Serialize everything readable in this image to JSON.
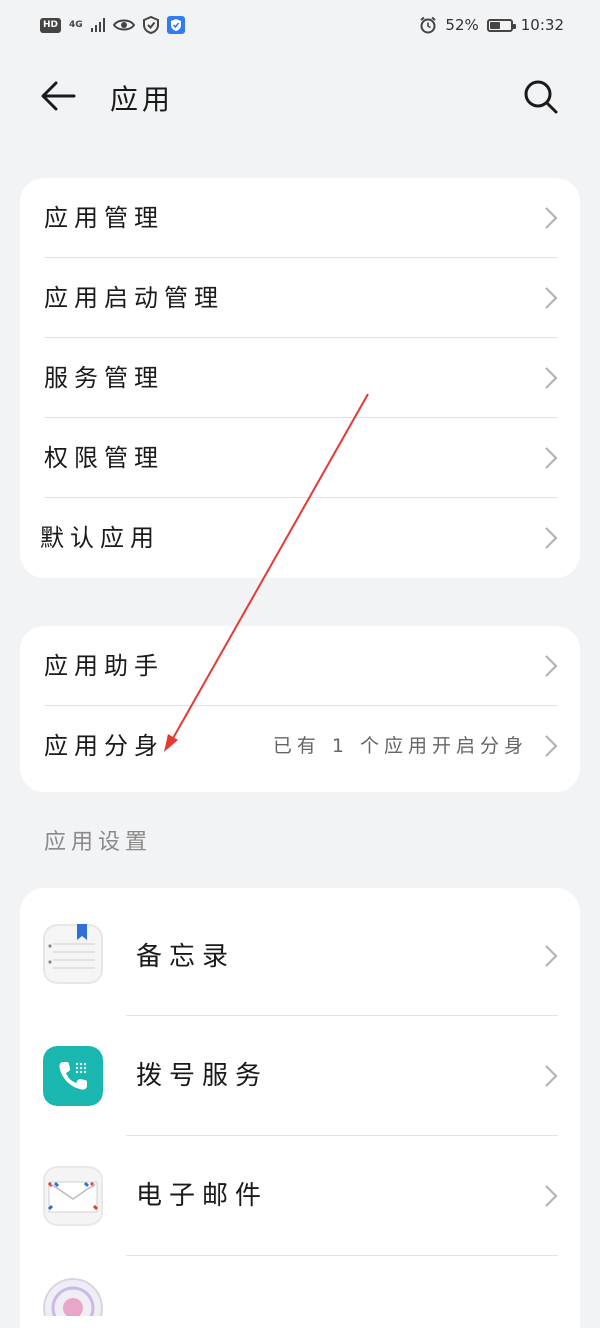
{
  "status_bar": {
    "left_badges": {
      "hd": "HD",
      "network": "4G"
    },
    "battery_percent_text": "52%",
    "battery_level": 0.52,
    "time": "10:32",
    "icons": [
      "hd-icon",
      "signal-icon",
      "eye-icon",
      "shield-check-icon",
      "vpn-shield-icon",
      "alarm-icon",
      "battery-icon"
    ]
  },
  "header": {
    "title": "应用",
    "back_icon": "back-arrow-icon",
    "search_icon": "search-icon"
  },
  "group1": {
    "items": [
      {
        "label": "应用管理"
      },
      {
        "label": "应用启动管理"
      },
      {
        "label": "服务管理"
      },
      {
        "label": "权限管理"
      },
      {
        "label": "默认应用"
      }
    ]
  },
  "group2": {
    "items": [
      {
        "label": "应用助手",
        "value": ""
      },
      {
        "label": "应用分身",
        "value": "已有 1 个应用开启分身"
      }
    ]
  },
  "section_title": "应用设置",
  "apps": [
    {
      "label": "备忘录",
      "icon": "notepad-icon"
    },
    {
      "label": "拨号服务",
      "icon": "phone-icon"
    },
    {
      "label": "电子邮件",
      "icon": "mail-icon"
    }
  ],
  "colors": {
    "background": "#f1f3f5",
    "card": "#ffffff",
    "annotation_arrow": "#e53935",
    "phone_icon": "#1ab6b0"
  }
}
